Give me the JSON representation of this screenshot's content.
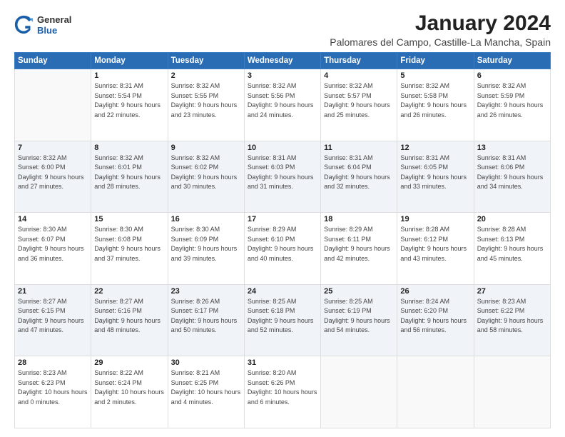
{
  "header": {
    "logo_general": "General",
    "logo_blue": "Blue",
    "month_title": "January 2024",
    "location": "Palomares del Campo, Castille-La Mancha, Spain"
  },
  "weekdays": [
    "Sunday",
    "Monday",
    "Tuesday",
    "Wednesday",
    "Thursday",
    "Friday",
    "Saturday"
  ],
  "weeks": [
    [
      {
        "day": "",
        "sunrise": "",
        "sunset": "",
        "daylight": ""
      },
      {
        "day": "1",
        "sunrise": "Sunrise: 8:31 AM",
        "sunset": "Sunset: 5:54 PM",
        "daylight": "Daylight: 9 hours and 22 minutes."
      },
      {
        "day": "2",
        "sunrise": "Sunrise: 8:32 AM",
        "sunset": "Sunset: 5:55 PM",
        "daylight": "Daylight: 9 hours and 23 minutes."
      },
      {
        "day": "3",
        "sunrise": "Sunrise: 8:32 AM",
        "sunset": "Sunset: 5:56 PM",
        "daylight": "Daylight: 9 hours and 24 minutes."
      },
      {
        "day": "4",
        "sunrise": "Sunrise: 8:32 AM",
        "sunset": "Sunset: 5:57 PM",
        "daylight": "Daylight: 9 hours and 25 minutes."
      },
      {
        "day": "5",
        "sunrise": "Sunrise: 8:32 AM",
        "sunset": "Sunset: 5:58 PM",
        "daylight": "Daylight: 9 hours and 26 minutes."
      },
      {
        "day": "6",
        "sunrise": "Sunrise: 8:32 AM",
        "sunset": "Sunset: 5:59 PM",
        "daylight": "Daylight: 9 hours and 26 minutes."
      }
    ],
    [
      {
        "day": "7",
        "sunrise": "Sunrise: 8:32 AM",
        "sunset": "Sunset: 6:00 PM",
        "daylight": "Daylight: 9 hours and 27 minutes."
      },
      {
        "day": "8",
        "sunrise": "Sunrise: 8:32 AM",
        "sunset": "Sunset: 6:01 PM",
        "daylight": "Daylight: 9 hours and 28 minutes."
      },
      {
        "day": "9",
        "sunrise": "Sunrise: 8:32 AM",
        "sunset": "Sunset: 6:02 PM",
        "daylight": "Daylight: 9 hours and 30 minutes."
      },
      {
        "day": "10",
        "sunrise": "Sunrise: 8:31 AM",
        "sunset": "Sunset: 6:03 PM",
        "daylight": "Daylight: 9 hours and 31 minutes."
      },
      {
        "day": "11",
        "sunrise": "Sunrise: 8:31 AM",
        "sunset": "Sunset: 6:04 PM",
        "daylight": "Daylight: 9 hours and 32 minutes."
      },
      {
        "day": "12",
        "sunrise": "Sunrise: 8:31 AM",
        "sunset": "Sunset: 6:05 PM",
        "daylight": "Daylight: 9 hours and 33 minutes."
      },
      {
        "day": "13",
        "sunrise": "Sunrise: 8:31 AM",
        "sunset": "Sunset: 6:06 PM",
        "daylight": "Daylight: 9 hours and 34 minutes."
      }
    ],
    [
      {
        "day": "14",
        "sunrise": "Sunrise: 8:30 AM",
        "sunset": "Sunset: 6:07 PM",
        "daylight": "Daylight: 9 hours and 36 minutes."
      },
      {
        "day": "15",
        "sunrise": "Sunrise: 8:30 AM",
        "sunset": "Sunset: 6:08 PM",
        "daylight": "Daylight: 9 hours and 37 minutes."
      },
      {
        "day": "16",
        "sunrise": "Sunrise: 8:30 AM",
        "sunset": "Sunset: 6:09 PM",
        "daylight": "Daylight: 9 hours and 39 minutes."
      },
      {
        "day": "17",
        "sunrise": "Sunrise: 8:29 AM",
        "sunset": "Sunset: 6:10 PM",
        "daylight": "Daylight: 9 hours and 40 minutes."
      },
      {
        "day": "18",
        "sunrise": "Sunrise: 8:29 AM",
        "sunset": "Sunset: 6:11 PM",
        "daylight": "Daylight: 9 hours and 42 minutes."
      },
      {
        "day": "19",
        "sunrise": "Sunrise: 8:28 AM",
        "sunset": "Sunset: 6:12 PM",
        "daylight": "Daylight: 9 hours and 43 minutes."
      },
      {
        "day": "20",
        "sunrise": "Sunrise: 8:28 AM",
        "sunset": "Sunset: 6:13 PM",
        "daylight": "Daylight: 9 hours and 45 minutes."
      }
    ],
    [
      {
        "day": "21",
        "sunrise": "Sunrise: 8:27 AM",
        "sunset": "Sunset: 6:15 PM",
        "daylight": "Daylight: 9 hours and 47 minutes."
      },
      {
        "day": "22",
        "sunrise": "Sunrise: 8:27 AM",
        "sunset": "Sunset: 6:16 PM",
        "daylight": "Daylight: 9 hours and 48 minutes."
      },
      {
        "day": "23",
        "sunrise": "Sunrise: 8:26 AM",
        "sunset": "Sunset: 6:17 PM",
        "daylight": "Daylight: 9 hours and 50 minutes."
      },
      {
        "day": "24",
        "sunrise": "Sunrise: 8:25 AM",
        "sunset": "Sunset: 6:18 PM",
        "daylight": "Daylight: 9 hours and 52 minutes."
      },
      {
        "day": "25",
        "sunrise": "Sunrise: 8:25 AM",
        "sunset": "Sunset: 6:19 PM",
        "daylight": "Daylight: 9 hours and 54 minutes."
      },
      {
        "day": "26",
        "sunrise": "Sunrise: 8:24 AM",
        "sunset": "Sunset: 6:20 PM",
        "daylight": "Daylight: 9 hours and 56 minutes."
      },
      {
        "day": "27",
        "sunrise": "Sunrise: 8:23 AM",
        "sunset": "Sunset: 6:22 PM",
        "daylight": "Daylight: 9 hours and 58 minutes."
      }
    ],
    [
      {
        "day": "28",
        "sunrise": "Sunrise: 8:23 AM",
        "sunset": "Sunset: 6:23 PM",
        "daylight": "Daylight: 10 hours and 0 minutes."
      },
      {
        "day": "29",
        "sunrise": "Sunrise: 8:22 AM",
        "sunset": "Sunset: 6:24 PM",
        "daylight": "Daylight: 10 hours and 2 minutes."
      },
      {
        "day": "30",
        "sunrise": "Sunrise: 8:21 AM",
        "sunset": "Sunset: 6:25 PM",
        "daylight": "Daylight: 10 hours and 4 minutes."
      },
      {
        "day": "31",
        "sunrise": "Sunrise: 8:20 AM",
        "sunset": "Sunset: 6:26 PM",
        "daylight": "Daylight: 10 hours and 6 minutes."
      },
      {
        "day": "",
        "sunrise": "",
        "sunset": "",
        "daylight": ""
      },
      {
        "day": "",
        "sunrise": "",
        "sunset": "",
        "daylight": ""
      },
      {
        "day": "",
        "sunrise": "",
        "sunset": "",
        "daylight": ""
      }
    ]
  ]
}
